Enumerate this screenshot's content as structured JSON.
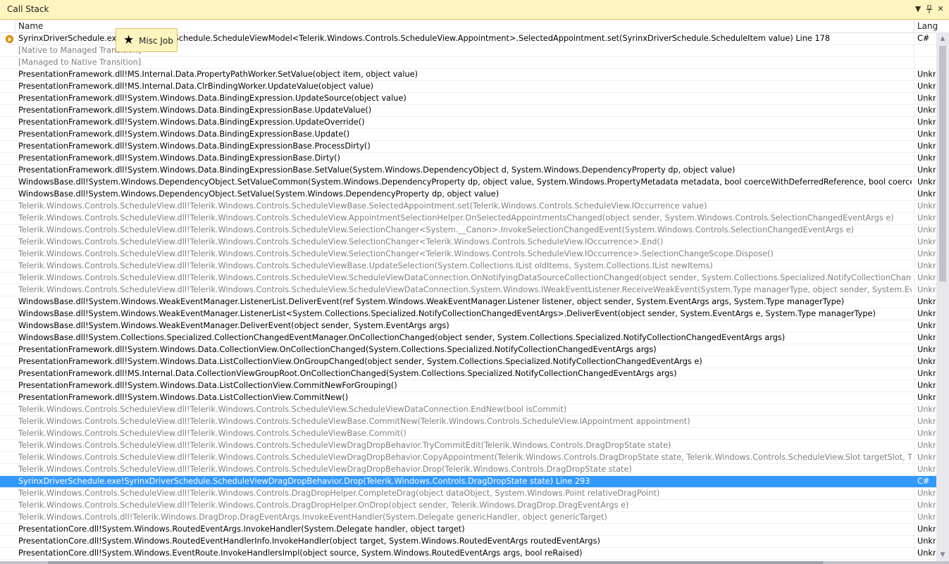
{
  "panel": {
    "title": "Call Stack",
    "dropdown_glyph": "▼",
    "pin_glyph": "📌",
    "close_glyph": "✕"
  },
  "columns": {
    "name": "Name",
    "language": "Lang"
  },
  "tooltip": {
    "icon": "star-icon",
    "star": "★",
    "label": "Misc Job"
  },
  "colors": {
    "selection": "#3399ff",
    "external_text": "#808080",
    "title_bar": "#fdf4bf"
  },
  "frames": [
    {
      "name": "SyrinxDriverSchedule.exe!SyrinxDriverSchedule.ScheduleViewModel<Telerik.Windows.Controls.ScheduleView.Appointment>.SelectedAppointment.set(SyrinxDriverSchedule.ScheduleItem value) Line 178",
      "lang": "C#",
      "kind": "user",
      "current": true
    },
    {
      "name": "[Native to Managed Transition]",
      "lang": "",
      "kind": "trans"
    },
    {
      "name": "[Managed to Native Transition]",
      "lang": "",
      "kind": "trans"
    },
    {
      "name": "PresentationFramework.dll!MS.Internal.Data.PropertyPathWorker.SetValue(object item, object value)",
      "lang": "Unkn",
      "kind": "user"
    },
    {
      "name": "PresentationFramework.dll!MS.Internal.Data.ClrBindingWorker.UpdateValue(object value)",
      "lang": "Unkn",
      "kind": "user"
    },
    {
      "name": "PresentationFramework.dll!System.Windows.Data.BindingExpression.UpdateSource(object value)",
      "lang": "Unkn",
      "kind": "user"
    },
    {
      "name": "PresentationFramework.dll!System.Windows.Data.BindingExpressionBase.UpdateValue()",
      "lang": "Unkn",
      "kind": "user"
    },
    {
      "name": "PresentationFramework.dll!System.Windows.Data.BindingExpression.UpdateOverride()",
      "lang": "Unkn",
      "kind": "user"
    },
    {
      "name": "PresentationFramework.dll!System.Windows.Data.BindingExpressionBase.Update()",
      "lang": "Unkn",
      "kind": "user"
    },
    {
      "name": "PresentationFramework.dll!System.Windows.Data.BindingExpressionBase.ProcessDirty()",
      "lang": "Unkn",
      "kind": "user"
    },
    {
      "name": "PresentationFramework.dll!System.Windows.Data.BindingExpressionBase.Dirty()",
      "lang": "Unkn",
      "kind": "user"
    },
    {
      "name": "PresentationFramework.dll!System.Windows.Data.BindingExpressionBase.SetValue(System.Windows.DependencyObject d, System.Windows.DependencyProperty dp, object value)",
      "lang": "Unkn",
      "kind": "user"
    },
    {
      "name": "WindowsBase.dll!System.Windows.DependencyObject.SetValueCommon(System.Windows.DependencyProperty dp, object value, System.Windows.PropertyMetadata metadata, bool coerceWithDeferredReference, bool coerceWithCurrentValu",
      "lang": "Unkn",
      "kind": "user"
    },
    {
      "name": "WindowsBase.dll!System.Windows.DependencyObject.SetValue(System.Windows.DependencyProperty dp, object value)",
      "lang": "Unkn",
      "kind": "user"
    },
    {
      "name": "Telerik.Windows.Controls.ScheduleView.dll!Telerik.Windows.Controls.ScheduleViewBase.SelectedAppointment.set(Telerik.Windows.Controls.ScheduleView.IOccurrence value)",
      "lang": "Unkn",
      "kind": "ext"
    },
    {
      "name": "Telerik.Windows.Controls.ScheduleView.dll!Telerik.Windows.Controls.ScheduleView.AppointmentSelectionHelper.OnSelectedAppointmentsChanged(object sender, System.Windows.Controls.SelectionChangedEventArgs e)",
      "lang": "Unkn",
      "kind": "ext"
    },
    {
      "name": "Telerik.Windows.Controls.ScheduleView.dll!Telerik.Windows.Controls.ScheduleView.SelectionChanger<System.__Canon>.InvokeSelectionChangedEvent(System.Windows.Controls.SelectionChangedEventArgs e)",
      "lang": "Unkn",
      "kind": "ext"
    },
    {
      "name": "Telerik.Windows.Controls.ScheduleView.dll!Telerik.Windows.Controls.ScheduleView.SelectionChanger<Telerik.Windows.Controls.ScheduleView.IOccurrence>.End()",
      "lang": "Unkn",
      "kind": "ext"
    },
    {
      "name": "Telerik.Windows.Controls.ScheduleView.dll!Telerik.Windows.Controls.ScheduleView.SelectionChanger<Telerik.Windows.Controls.ScheduleView.IOccurrence>.SelectionChangeScope.Dispose()",
      "lang": "Unkn",
      "kind": "ext"
    },
    {
      "name": "Telerik.Windows.Controls.ScheduleView.dll!Telerik.Windows.Controls.ScheduleViewBase.UpdateSelection(System.Collections.IList oldItems, System.Collections.IList newItems)",
      "lang": "Unkn",
      "kind": "ext"
    },
    {
      "name": "Telerik.Windows.Controls.ScheduleView.dll!Telerik.Windows.Controls.ScheduleView.ScheduleViewDataConnection.OnNotifyingDataSourceCollectionChanged(object sender, System.Collections.Specialized.NotifyCollectionChangedEventArgs",
      "lang": "Unkn",
      "kind": "ext"
    },
    {
      "name": "Telerik.Windows.Controls.ScheduleView.dll!Telerik.Windows.Controls.ScheduleView.ScheduleViewDataConnection.System.Windows.IWeakEventListener.ReceiveWeakEvent(System.Type managerType, object sender, System.EventArgs e)",
      "lang": "Unkn",
      "kind": "ext"
    },
    {
      "name": "WindowsBase.dll!System.Windows.WeakEventManager.ListenerList.DeliverEvent(ref System.Windows.WeakEventManager.Listener listener, object sender, System.EventArgs args, System.Type managerType)",
      "lang": "Unkn",
      "kind": "user"
    },
    {
      "name": "WindowsBase.dll!System.Windows.WeakEventManager.ListenerList<System.Collections.Specialized.NotifyCollectionChangedEventArgs>.DeliverEvent(object sender, System.EventArgs e, System.Type managerType)",
      "lang": "Unkn",
      "kind": "user"
    },
    {
      "name": "WindowsBase.dll!System.Windows.WeakEventManager.DeliverEvent(object sender, System.EventArgs args)",
      "lang": "Unkn",
      "kind": "user"
    },
    {
      "name": "WindowsBase.dll!System.Collections.Specialized.CollectionChangedEventManager.OnCollectionChanged(object sender, System.Collections.Specialized.NotifyCollectionChangedEventArgs args)",
      "lang": "Unkn",
      "kind": "user"
    },
    {
      "name": "PresentationFramework.dll!System.Windows.Data.CollectionView.OnCollectionChanged(System.Collections.Specialized.NotifyCollectionChangedEventArgs args)",
      "lang": "Unkn",
      "kind": "user"
    },
    {
      "name": "PresentationFramework.dll!System.Windows.Data.ListCollectionView.OnGroupChanged(object sender, System.Collections.Specialized.NotifyCollectionChangedEventArgs e)",
      "lang": "Unkn",
      "kind": "user"
    },
    {
      "name": "PresentationFramework.dll!MS.Internal.Data.CollectionViewGroupRoot.OnCollectionChanged(System.Collections.Specialized.NotifyCollectionChangedEventArgs args)",
      "lang": "Unkn",
      "kind": "user"
    },
    {
      "name": "PresentationFramework.dll!System.Windows.Data.ListCollectionView.CommitNewForGrouping()",
      "lang": "Unkn",
      "kind": "user"
    },
    {
      "name": "PresentationFramework.dll!System.Windows.Data.ListCollectionView.CommitNew()",
      "lang": "Unkn",
      "kind": "user"
    },
    {
      "name": "Telerik.Windows.Controls.ScheduleView.dll!Telerik.Windows.Controls.ScheduleView.ScheduleViewDataConnection.EndNew(bool isCommit)",
      "lang": "Unkn",
      "kind": "ext"
    },
    {
      "name": "Telerik.Windows.Controls.ScheduleView.dll!Telerik.Windows.Controls.ScheduleViewBase.CommitNew(Telerik.Windows.Controls.ScheduleView.IAppointment appointment)",
      "lang": "Unkn",
      "kind": "ext"
    },
    {
      "name": "Telerik.Windows.Controls.ScheduleView.dll!Telerik.Windows.Controls.ScheduleViewBase.Commit()",
      "lang": "Unkn",
      "kind": "ext"
    },
    {
      "name": "Telerik.Windows.Controls.ScheduleView.dll!Telerik.Windows.Controls.ScheduleViewDragDropBehavior.TryCommitEdit(Telerik.Windows.Controls.DragDropState state)",
      "lang": "Unkn",
      "kind": "ext"
    },
    {
      "name": "Telerik.Windows.Controls.ScheduleView.dll!Telerik.Windows.Controls.ScheduleViewDragDropBehavior.CopyAppointment(Telerik.Windows.Controls.DragDropState state, Telerik.Windows.Controls.ScheduleView.Slot targetSlot, Telerik.Window",
      "lang": "Unkn",
      "kind": "ext"
    },
    {
      "name": "Telerik.Windows.Controls.ScheduleView.dll!Telerik.Windows.Controls.ScheduleViewDragDropBehavior.Drop(Telerik.Windows.Controls.DragDropState state)",
      "lang": "Unkn",
      "kind": "ext"
    },
    {
      "name": "SyrinxDriverSchedule.exe!SyrinxDriverSchedule.ScheduleViewDragDropBehavior.Drop(Telerik.Windows.Controls.DragDropState state) Line 293",
      "lang": "C#",
      "kind": "sel"
    },
    {
      "name": "Telerik.Windows.Controls.ScheduleView.dll!Telerik.Windows.Controls.DragDropHelper.CompleteDrag(object dataObject, System.Windows.Point relativeDragPoint)",
      "lang": "Unkn",
      "kind": "ext"
    },
    {
      "name": "Telerik.Windows.Controls.ScheduleView.dll!Telerik.Windows.Controls.DragDropHelper.OnDrop(object sender, Telerik.Windows.DragDrop.DragEventArgs e)",
      "lang": "Unkn",
      "kind": "ext"
    },
    {
      "name": "Telerik.Windows.Controls.dll!Telerik.Windows.DragDrop.DragEventArgs.InvokeEventHandler(System.Delegate genericHandler, object genericTarget)",
      "lang": "Unkn",
      "kind": "ext"
    },
    {
      "name": "PresentationCore.dll!System.Windows.RoutedEventArgs.InvokeHandler(System.Delegate handler, object target)",
      "lang": "Unkn",
      "kind": "user"
    },
    {
      "name": "PresentationCore.dll!System.Windows.RoutedEventHandlerInfo.InvokeHandler(object target, System.Windows.RoutedEventArgs routedEventArgs)",
      "lang": "Unkn",
      "kind": "user"
    },
    {
      "name": "PresentationCore.dll!System.Windows.EventRoute.InvokeHandlersImpl(object source, System.Windows.RoutedEventArgs args, bool reRaised)",
      "lang": "Unkn",
      "kind": "user"
    }
  ]
}
